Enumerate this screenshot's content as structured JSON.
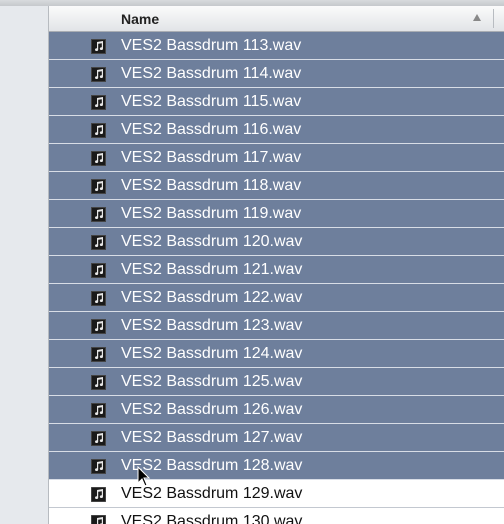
{
  "list": {
    "column_header": "Name",
    "rows": [
      {
        "name": "VES2 Bassdrum 113.wav",
        "selected": true,
        "icon": "audio-file-icon"
      },
      {
        "name": "VES2 Bassdrum 114.wav",
        "selected": true,
        "icon": "audio-file-icon"
      },
      {
        "name": "VES2 Bassdrum 115.wav",
        "selected": true,
        "icon": "audio-file-icon"
      },
      {
        "name": "VES2 Bassdrum 116.wav",
        "selected": true,
        "icon": "audio-file-icon"
      },
      {
        "name": "VES2 Bassdrum 117.wav",
        "selected": true,
        "icon": "audio-file-icon"
      },
      {
        "name": "VES2 Bassdrum 118.wav",
        "selected": true,
        "icon": "audio-file-icon"
      },
      {
        "name": "VES2 Bassdrum 119.wav",
        "selected": true,
        "icon": "audio-file-icon"
      },
      {
        "name": "VES2 Bassdrum 120.wav",
        "selected": true,
        "icon": "audio-file-icon"
      },
      {
        "name": "VES2 Bassdrum 121.wav",
        "selected": true,
        "icon": "audio-file-icon"
      },
      {
        "name": "VES2 Bassdrum 122.wav",
        "selected": true,
        "icon": "audio-file-icon"
      },
      {
        "name": "VES2 Bassdrum 123.wav",
        "selected": true,
        "icon": "audio-file-icon"
      },
      {
        "name": "VES2 Bassdrum 124.wav",
        "selected": true,
        "icon": "audio-file-icon"
      },
      {
        "name": "VES2 Bassdrum 125.wav",
        "selected": true,
        "icon": "audio-file-icon"
      },
      {
        "name": "VES2 Bassdrum 126.wav",
        "selected": true,
        "icon": "audio-file-icon"
      },
      {
        "name": "VES2 Bassdrum 127.wav",
        "selected": true,
        "icon": "audio-file-icon"
      },
      {
        "name": "VES2 Bassdrum 128.wav",
        "selected": true,
        "icon": "audio-file-icon"
      },
      {
        "name": "VES2 Bassdrum 129.wav",
        "selected": false,
        "icon": "audio-file-icon"
      },
      {
        "name": "VES2 Bassdrum 130.wav",
        "selected": false,
        "icon": "audio-file-icon"
      }
    ]
  },
  "colors": {
    "selection": "#6e7f9c",
    "selected_text": "#ffffff",
    "text": "#111111"
  }
}
